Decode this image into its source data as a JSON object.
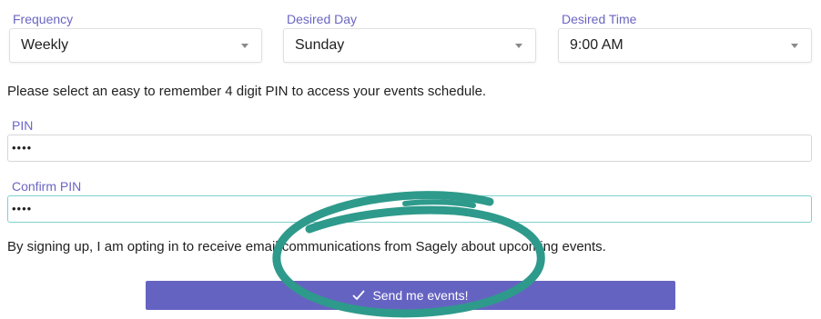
{
  "schedule": {
    "frequency": {
      "label": "Frequency",
      "value": "Weekly"
    },
    "day": {
      "label": "Desired Day",
      "value": "Sunday"
    },
    "time": {
      "label": "Desired Time",
      "value": "9:00 AM"
    }
  },
  "instructions": "Please select an easy to remember 4 digit PIN to access your events schedule.",
  "pin": {
    "label": "PIN",
    "value": "••••"
  },
  "confirm_pin": {
    "label": "Confirm PIN",
    "value": "••••"
  },
  "optin_text": "By signing up, I am opting in to receive email communications from Sagely about upcoming events.",
  "submit": {
    "label": "Send me events!",
    "icon": "check-icon"
  },
  "colors": {
    "accent": "#6563c2",
    "label": "#6b66c2",
    "focus_border": "#7fd0d0",
    "annotation": "#2e9a8b"
  }
}
